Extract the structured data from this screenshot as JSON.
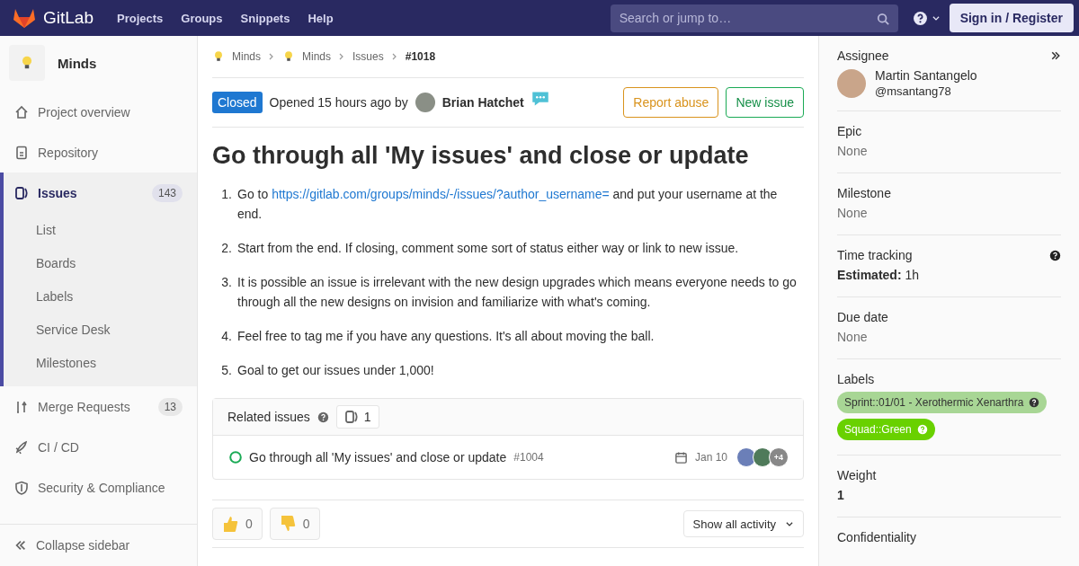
{
  "header": {
    "brand": "GitLab",
    "nav": [
      "Projects",
      "Groups",
      "Snippets",
      "Help"
    ],
    "search": {
      "placeholder": "Search or jump to…"
    },
    "sign_in": "Sign in / Register"
  },
  "sidebar": {
    "project": "Minds",
    "items": [
      {
        "label": "Project overview",
        "selected": false
      },
      {
        "label": "Repository",
        "selected": false
      },
      {
        "label": "Issues",
        "count": "143",
        "selected": true,
        "children": [
          {
            "label": "List",
            "selected": false
          },
          {
            "label": "Boards",
            "selected": false
          },
          {
            "label": "Labels",
            "selected": false
          },
          {
            "label": "Service Desk",
            "selected": false
          },
          {
            "label": "Milestones",
            "selected": false
          }
        ]
      },
      {
        "label": "Merge Requests",
        "count": "13",
        "selected": false
      },
      {
        "label": "CI / CD",
        "selected": false
      },
      {
        "label": "Security & Compliance",
        "selected": false
      }
    ],
    "collapse": "Collapse sidebar"
  },
  "breadcrumbs": [
    {
      "label": "Minds",
      "kind": "project"
    },
    {
      "label": "Minds",
      "kind": "project"
    },
    {
      "label": "Issues",
      "kind": "page"
    },
    {
      "label": "#1018",
      "kind": "current"
    }
  ],
  "issue": {
    "status": "Closed",
    "opened": "Opened 15 hours ago by",
    "author": "Brian Hatchet",
    "report": "Report abuse",
    "new_issue": "New issue",
    "title": "Go through all 'My issues' and close or update",
    "steps": [
      {
        "marker": "1.",
        "before": "Go to ",
        "link": "https://gitlab.com/groups/minds/-/issues/?author_username=",
        "after": " and put your username at the end."
      },
      {
        "marker": "2.",
        "before": "Start from the end. If closing, comment some sort of status either way or link to new issue."
      },
      {
        "marker": "3.",
        "before": "It is possible an issue is irrelevant with the new design upgrades which means everyone needs to go through all the new designs on invision and familiarize with what's coming."
      },
      {
        "marker": "4.",
        "before": "Feel free to tag me if you have any questions. It's all about moving the ball."
      },
      {
        "marker": "5.",
        "before": "Goal to get our issues under 1,000!"
      }
    ]
  },
  "related": {
    "title": "Related issues",
    "count": "1",
    "items": [
      {
        "title": "Go through all 'My issues' and close or update",
        "number": "#1004",
        "date": "Jan 10",
        "more": "+4"
      }
    ]
  },
  "awards": [
    {
      "kind": "up",
      "count": "0"
    },
    {
      "kind": "down",
      "count": "0"
    }
  ],
  "activity": "Show all activity",
  "right": {
    "assignee": {
      "label": "Assignee",
      "name": "Martin Santangelo",
      "username": "@msantang78"
    },
    "sections": [
      {
        "kind": "text",
        "label": "Epic",
        "value": "None"
      },
      {
        "kind": "text",
        "label": "Milestone",
        "value": "None"
      },
      {
        "kind": "time",
        "label": "Time tracking",
        "key": "Estimated:",
        "value": "1h"
      },
      {
        "kind": "text",
        "label": "Due date",
        "value": "None"
      },
      {
        "kind": "labels",
        "label": "Labels",
        "labels": [
          {
            "text": "Sprint::01/01 - Xerothermic Xenarthra",
            "color": "#a8d695"
          },
          {
            "text": "Squad::Green",
            "color": "#69d100"
          }
        ]
      },
      {
        "kind": "bold",
        "label": "Weight",
        "value": "1"
      },
      {
        "kind": "heading",
        "label": "Confidentiality"
      }
    ]
  }
}
